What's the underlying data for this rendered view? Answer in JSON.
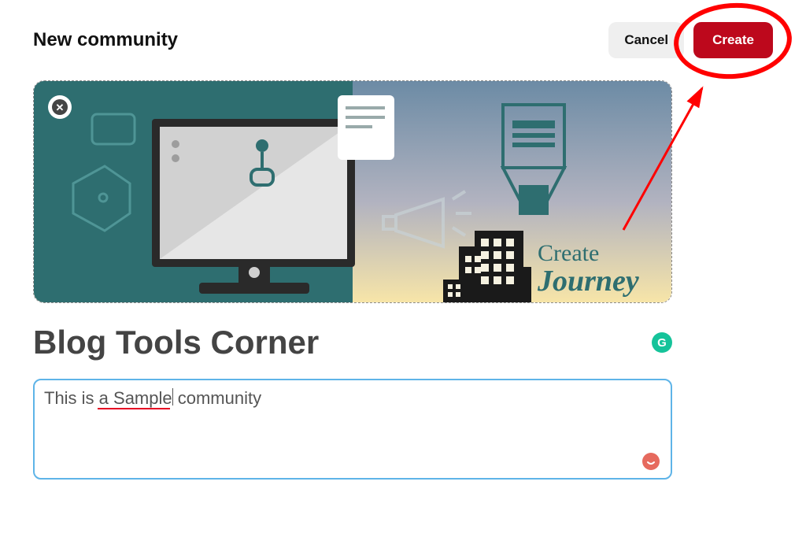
{
  "header": {
    "title": "New community",
    "cancel_label": "Cancel",
    "create_label": "Create"
  },
  "banner": {
    "close_icon": "✕",
    "caption_line1": "Create",
    "caption_line2": "Journey"
  },
  "community": {
    "name": "Blog Tools Corner",
    "description": "This is a Sample community",
    "grammarly_glyph": "G"
  },
  "colors": {
    "brand_red": "#bd081c",
    "annotation_red": "#ff0000",
    "focus_blue": "#5eb4e8",
    "grammarly_green": "#15c39a",
    "spell_red": "#e66a5e"
  }
}
